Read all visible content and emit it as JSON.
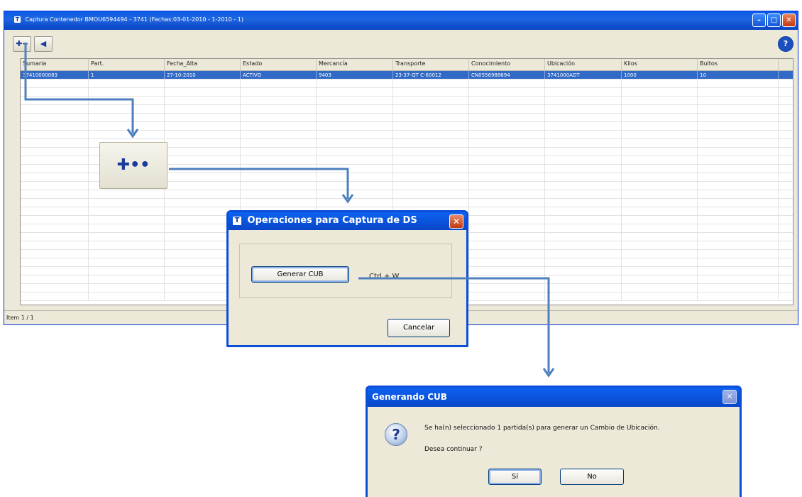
{
  "main_window": {
    "title": "Captura Contenedor BMOU6594494 - 3741 (Fechas:03-01-2010 - 1-2010 - 1)",
    "app_icon": "T",
    "title_buttons": {
      "minimize": "–",
      "maximize": "□",
      "close": "✕"
    },
    "toolbar": {
      "add_button": "✚··",
      "back_button": "◀",
      "help_button": "?"
    },
    "grid": {
      "columns": [
        "Sumaria",
        "Part.",
        "Fecha_Alta",
        "Estado",
        "Mercancía",
        "Transporte",
        "Conocimiento",
        "Ubicación",
        "Kilos",
        "Bultos"
      ],
      "rows": [
        [
          "37410000083",
          "1",
          "27-10-2010",
          "ACTIVO",
          "9403",
          "23-37-QT C-60012",
          "CN0556988694",
          "3741000ADT",
          "1000",
          "10"
        ]
      ]
    },
    "status": "Item 1 / 1"
  },
  "zoom_button": {
    "label": "✚••"
  },
  "ops_dialog": {
    "icon": "T",
    "title": "Operaciones para Captura de DS",
    "close": "✕",
    "generate_button": "Generar CUB",
    "shortcut": "Ctrl + W",
    "cancel_button": "Cancelar"
  },
  "gen_dialog": {
    "title": "Generando CUB",
    "close": "✕",
    "icon": "?",
    "message": "Se ha(n) seleccionado 1 partida(s) para generar un Cambio de Ubicación.",
    "question": "Desea continuar ?",
    "yes_button": "Sí",
    "no_button": "No"
  },
  "colors": {
    "xp_blue": "#0b4fd8",
    "selection": "#3169c6",
    "arrow": "#4e7fbe",
    "window_bg": "#ece9d8"
  }
}
